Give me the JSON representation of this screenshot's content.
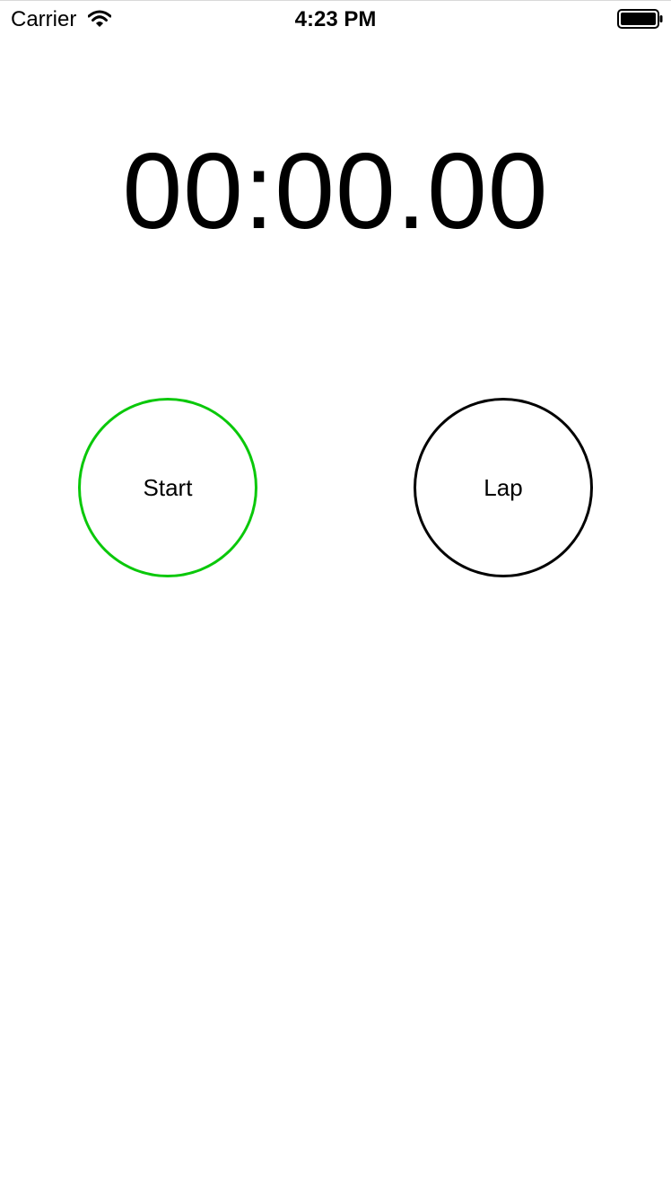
{
  "status_bar": {
    "carrier": "Carrier",
    "time": "4:23 PM",
    "icons": [
      "wifi-icon",
      "battery-icon"
    ]
  },
  "stopwatch": {
    "display": "00:00.00"
  },
  "controls": {
    "start_label": "Start",
    "start_color": "#0ac80a",
    "lap_label": "Lap",
    "lap_color": "#000000"
  }
}
